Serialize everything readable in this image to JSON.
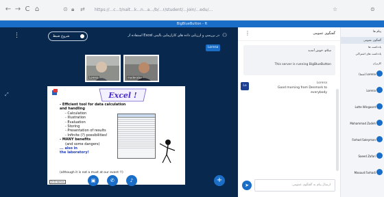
{
  "browser": {
    "url": "https://...c...t/nalt...k...n...a.../b/...r/student/...join/...edu/...",
    "nav": [
      "←",
      "→",
      "C",
      "⌂"
    ]
  },
  "app": {
    "title": "BigBlueButton - ft"
  },
  "main": {
    "record_label": "شروع ضبط",
    "meeting_title": "استفاده از Excel در بررسی و ارزیابی داده های کارآزمایی بالینی",
    "presenter_tag": "Lorena",
    "cameras": [
      {
        "label": "Lorena"
      },
      {
        "label": "moderator"
      }
    ]
  },
  "slide": {
    "title": "Excel !",
    "bullets": [
      {
        "text": "- Efficient tool for data calculation and handling",
        "level": 1
      },
      {
        "text": "- Calculation",
        "level": 2
      },
      {
        "text": "- Illustration",
        "level": 2
      },
      {
        "text": "- Evaluation",
        "level": 2
      },
      {
        "text": "- Storing",
        "level": 2
      },
      {
        "text": "- Presentation of results",
        "level": 2
      },
      {
        "text": "- Infinite (?) possibilities!",
        "level": 2
      },
      {
        "text": "- MANY benefits",
        "level": 1
      },
      {
        "text": "(and some dangers)",
        "level": 2
      },
      {
        "text": "... also in",
        "level": 3
      },
      {
        "text": "the laboratory!",
        "level": 3
      }
    ],
    "footnote": "(although it is not a must at our event !!)",
    "badge": "Dr.Erasmus"
  },
  "controls": [
    {
      "name": "camera",
      "glyph": "▣"
    },
    {
      "name": "phone",
      "glyph": "✆"
    },
    {
      "name": "mic",
      "glyph": "♪"
    }
  ],
  "chat": {
    "title": "گفتگوی عمومی",
    "welcome_1": "سلام، خوش آمدید",
    "welcome_2": "This server is running BigBlueButton",
    "msg_avatar": "Lo",
    "msg_sender": "Lorena",
    "msg_text_1": "Good morning from Denmark to",
    "msg_text_2": "everybody",
    "placeholder": "ارسال پیام به گفتگوی عمومی"
  },
  "users": {
    "header": "پیام ها",
    "nav": [
      "گفتگوی عمومی",
      "یادداشت ها",
      "یادداشت های اشتراکی"
    ],
    "list_header": "کاربران",
    "people": [
      "(شما) Lorena",
      "Lorena",
      "Lotte Wingaard",
      "Mohammad Zadeh",
      "Farhad Soleyman",
      "Saeed Zafari",
      "Masoud Farhadi"
    ]
  }
}
